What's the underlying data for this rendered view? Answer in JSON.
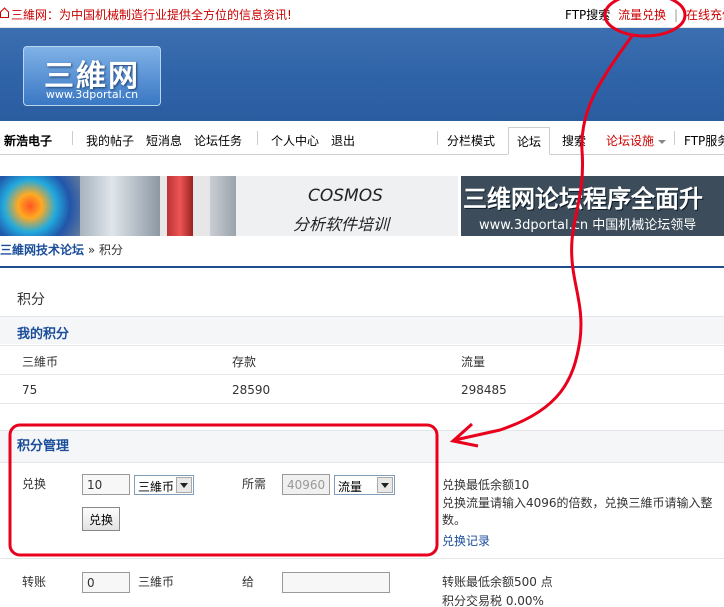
{
  "topbar": {
    "slogan": "三維网：为中国机械制造行业提供全方位的信息资讯!",
    "links": {
      "ftp_search": "FTP搜索",
      "flow_exchange": "流量兑换",
      "separator": "|",
      "online_recharge": "在线充值"
    }
  },
  "header": {
    "logo_title": "三維网",
    "logo_url": "www.3dportal.cn"
  },
  "nav": {
    "user": "新浩电子",
    "my_posts": "我的帖子",
    "messages": "短消息",
    "tasks": "论坛任务",
    "profile": "个人中心",
    "logout": "退出",
    "split_mode": "分栏模式",
    "forum": "论坛",
    "search": "搜索",
    "forum_settings": "论坛设施",
    "ftp_service": "FTP服务"
  },
  "banners": {
    "left_line1": "COSMOS",
    "left_line2": "分析软件培训",
    "right_line1": "三维网论坛程序全面升",
    "right_line2": "www.3dportal.cn  中国机械论坛领导"
  },
  "breadcrumb": {
    "root": "三維网技术论坛",
    "sep": "»",
    "current": "积分"
  },
  "page": {
    "title": "积分",
    "my_points": {
      "heading": "我的积分",
      "columns": [
        "三維币",
        "存款",
        "流量"
      ],
      "values": [
        "75",
        "28590",
        "298485"
      ]
    },
    "management": {
      "heading": "积分管理",
      "exchange_label": "兑换",
      "exchange_amount": "10",
      "exchange_currency": "三維币",
      "required_label": "所需",
      "required_amount": "40960",
      "required_currency": "流量",
      "exchange_button": "兑换",
      "min_balance": "兑换最低余额10",
      "warning": "兑换流量请输入4096的倍数，兑换三維币请输入整数。",
      "record_link": "兑换记录"
    },
    "transfer": {
      "label": "转账",
      "amount": "0",
      "currency": "三維币",
      "to_label": "给",
      "recipient": "",
      "min_balance": "转账最低余额500 点",
      "tax": "积分交易税  0.00%"
    }
  },
  "colors": {
    "link_blue": "#1a4d9a",
    "alert_red": "#cc0000",
    "header_blue": "#2f63a8",
    "annotation_red": "#e8001c"
  }
}
